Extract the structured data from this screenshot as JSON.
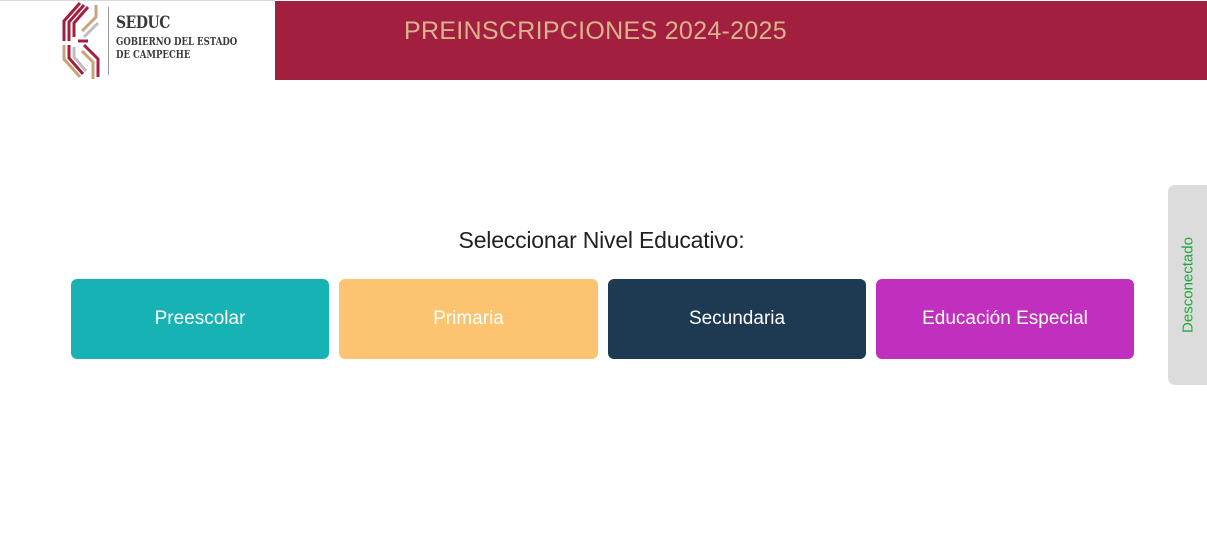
{
  "brand": {
    "name": "SEDUC",
    "line2": "GOBIERNO DEL ESTADO",
    "line3": "DE CAMPECHE",
    "colors": {
      "maroon": "#a31f40",
      "gold": "#d9b48a",
      "gray": "#bdbdbd"
    }
  },
  "header": {
    "title": "PREINSCRIPCIONES 2024-2025",
    "background": "#a31f40",
    "title_color": "#d9b48a"
  },
  "main": {
    "prompt": "Seleccionar Nivel Educativo:",
    "levels": [
      {
        "label": "Preescolar",
        "color": "#17b3b4"
      },
      {
        "label": "Primaria",
        "color": "#fcc470"
      },
      {
        "label": "Secundaria",
        "color": "#1e3a52"
      },
      {
        "label": "Educación Especial",
        "color": "#c12fbe"
      }
    ]
  },
  "status": {
    "label": "Desconectado",
    "color": "#1faa3c"
  }
}
